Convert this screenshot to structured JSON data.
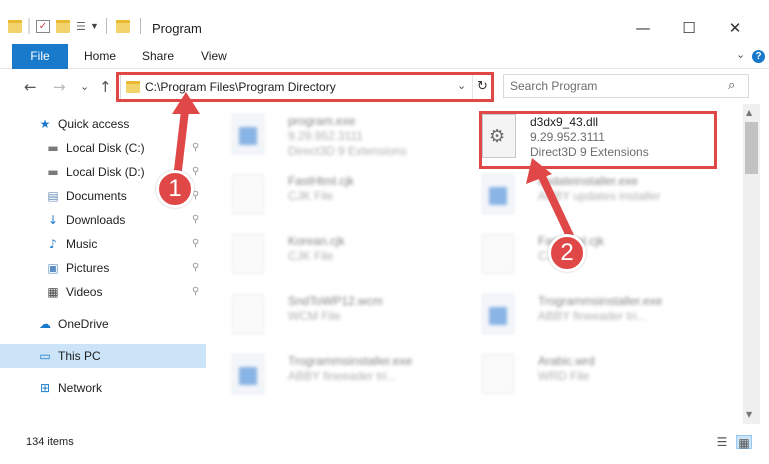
{
  "window": {
    "title": "Program",
    "minimize_glyph": "—",
    "maximize_glyph": "☐",
    "close_glyph": "✕"
  },
  "ribbon": {
    "tabs": [
      "File",
      "Home",
      "Share",
      "View"
    ],
    "expand_glyph": "⌄",
    "help_glyph": "?"
  },
  "navigation": {
    "back_glyph": "←",
    "forward_glyph": "→",
    "recent_glyph": "⌄",
    "up_glyph": "↑"
  },
  "address_bar": {
    "path": "C:\\Program Files\\Program Directory",
    "dropdown_glyph": "⌄",
    "refresh_glyph": "↻"
  },
  "search": {
    "placeholder": "Search Program",
    "icon_glyph": "⌕"
  },
  "sidebar": {
    "items": [
      {
        "label": "Quick access",
        "icon": "star-icon",
        "glyph": "★",
        "color": "#1979ca",
        "pinned": false
      },
      {
        "label": "Local Disk (C:)",
        "icon": "drive-icon",
        "glyph": "▬",
        "color": "#7a7a7a",
        "pinned": true
      },
      {
        "label": "Local Disk (D:)",
        "icon": "drive-icon",
        "glyph": "▬",
        "color": "#7a7a7a",
        "pinned": true
      },
      {
        "label": "Documents",
        "icon": "documents-icon",
        "glyph": "▤",
        "color": "#6b8fb8",
        "pinned": true
      },
      {
        "label": "Downloads",
        "icon": "download-icon",
        "glyph": "↓",
        "color": "#1979ca",
        "pinned": true
      },
      {
        "label": "Music",
        "icon": "music-icon",
        "glyph": "♪",
        "color": "#1979ca",
        "pinned": true
      },
      {
        "label": "Pictures",
        "icon": "pictures-icon",
        "glyph": "▣",
        "color": "#5b8fc4",
        "pinned": true
      },
      {
        "label": "Videos",
        "icon": "video-icon",
        "glyph": "▦",
        "color": "#444444",
        "pinned": true
      },
      {
        "label": "OneDrive",
        "icon": "cloud-icon",
        "glyph": "☁",
        "color": "#1979ca",
        "pinned": false
      },
      {
        "label": "This PC",
        "icon": "computer-icon",
        "glyph": "▭",
        "color": "#1979ca",
        "pinned": false
      },
      {
        "label": "Network",
        "icon": "network-icon",
        "glyph": "⊞",
        "color": "#1979ca",
        "pinned": false
      }
    ],
    "pin_glyph": "⚲"
  },
  "files": {
    "highlighted": {
      "name": "d3dx9_43.dll",
      "version": "9.29.952.3111",
      "description": "Direct3D 9 Extensions",
      "icon_glyph": "⚙"
    },
    "others": [
      {
        "name": "program.exe",
        "line2": "9.29.952.3111",
        "line3": "Direct3D 9 Extensions",
        "type": "exe"
      },
      {
        "name": "FastHtml.cjk",
        "line2": "CJK File",
        "line3": "",
        "type": "doc"
      },
      {
        "name": "updateinstaller.exe",
        "line2": "ABBY updates installer",
        "line3": "",
        "type": "exe"
      },
      {
        "name": "Korean.cjk",
        "line2": "CJK File",
        "line3": "",
        "type": "doc"
      },
      {
        "name": "FastHtml.cjk",
        "line2": "CJK File",
        "line3": "",
        "type": "doc"
      },
      {
        "name": "SndToWP12.wcm",
        "line2": "WCM File",
        "line3": "",
        "type": "doc"
      },
      {
        "name": "Trogrammsinstaller.exe",
        "line2": "ABBY fineeader tri...",
        "line3": "",
        "type": "exe"
      },
      {
        "name": "Trogrammsinstaller.exe",
        "line2": "ABBY fineeader tri...",
        "line3": "",
        "type": "exe"
      },
      {
        "name": "Arabic.wrd",
        "line2": "WRD File",
        "line3": "",
        "type": "doc"
      }
    ]
  },
  "status": {
    "item_count": "134 items",
    "details_view_glyph": "☰",
    "large_icons_view_glyph": "▦"
  },
  "callouts": [
    "1",
    "2"
  ],
  "colors": {
    "accent": "#1979ca",
    "highlight": "#e04848",
    "selection": "#cce4f7"
  }
}
